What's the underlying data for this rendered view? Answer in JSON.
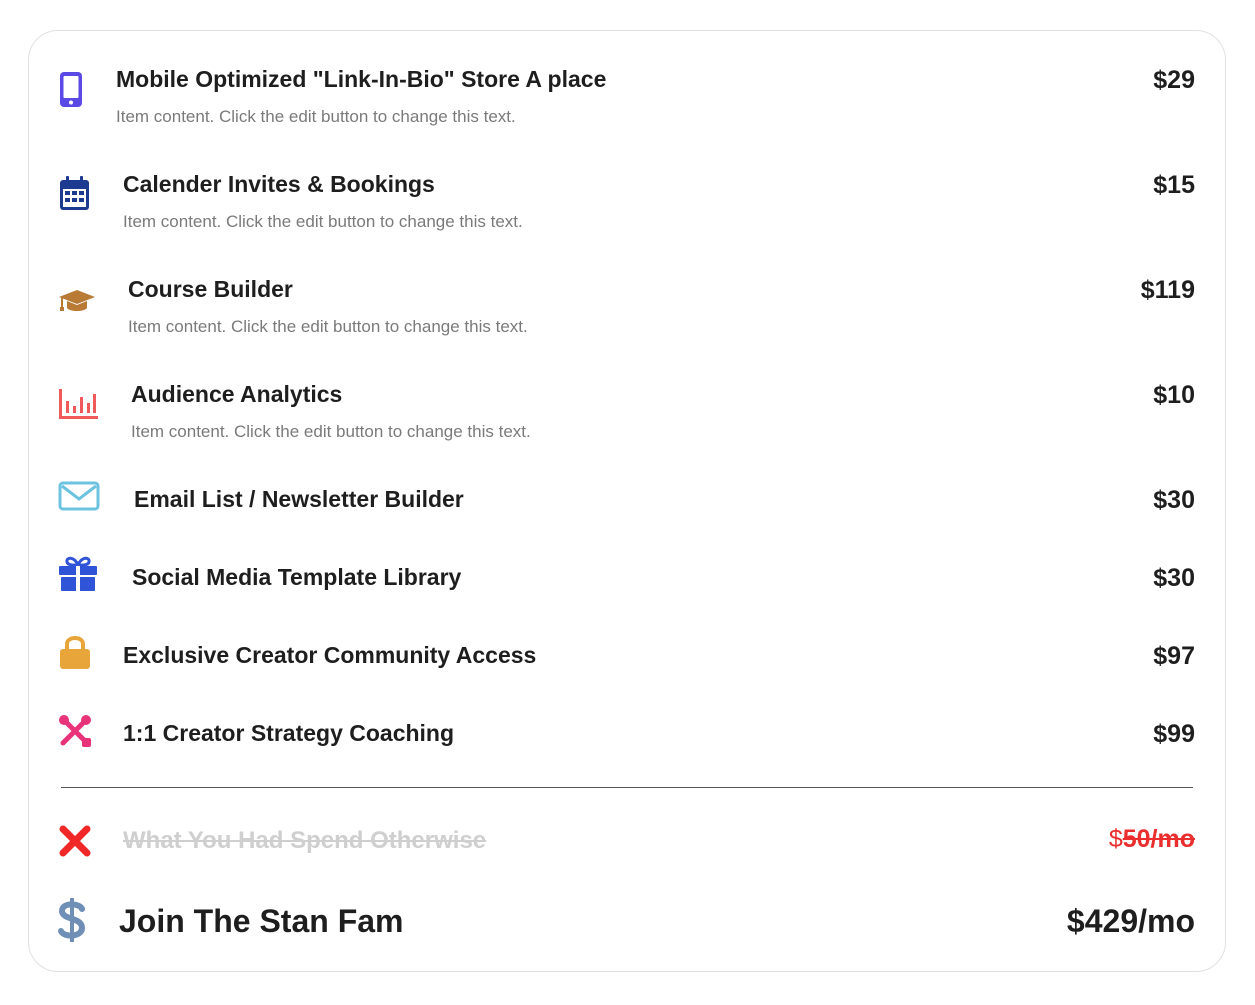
{
  "items": [
    {
      "icon": "mobile-phone-icon",
      "title": "Mobile Optimized \"Link-In-Bio\" Store A place",
      "desc": "Item content. Click the edit button to change this text.",
      "price": "$29"
    },
    {
      "icon": "calendar-icon",
      "title": "Calender Invites & Bookings",
      "desc": "Item content. Click the edit button to change this text.",
      "price": "$15"
    },
    {
      "icon": "graduation-cap-icon",
      "title": "Course Builder",
      "desc": "Item content. Click the edit button to change this text.",
      "price": "$119"
    },
    {
      "icon": "bar-chart-icon",
      "title": "Audience Analytics",
      "desc": "Item content. Click the edit button to change this text.",
      "price": "$10"
    },
    {
      "icon": "envelope-icon",
      "title": "Email List / Newsletter Builder",
      "price": "$30"
    },
    {
      "icon": "gift-icon",
      "title": "Social Media Template Library",
      "price": "$30"
    },
    {
      "icon": "lock-icon",
      "title": "Exclusive Creator Community Access",
      "price": "$97"
    },
    {
      "icon": "tools-icon",
      "title": "1:1 Creator Strategy Coaching",
      "price": "$99"
    }
  ],
  "otherwise": {
    "icon": "x-mark-icon",
    "title": "What You Had Spend Otherwise",
    "currency": "$",
    "amount": "50/mo"
  },
  "join": {
    "icon": "dollar-sign-icon",
    "title": "Join The Stan Fam",
    "price": "$429/mo"
  },
  "colors": {
    "mobile": "#5b49e6",
    "calendar": "#1c3a8f",
    "cap": "#b87a35",
    "chart": "#f05a5a",
    "envelope": "#6cc3df",
    "gift": "#2f54d8",
    "lock": "#e8a53a",
    "tools": "#e8337b",
    "xmark": "#f02828",
    "dollar": "#6f8fb7"
  }
}
